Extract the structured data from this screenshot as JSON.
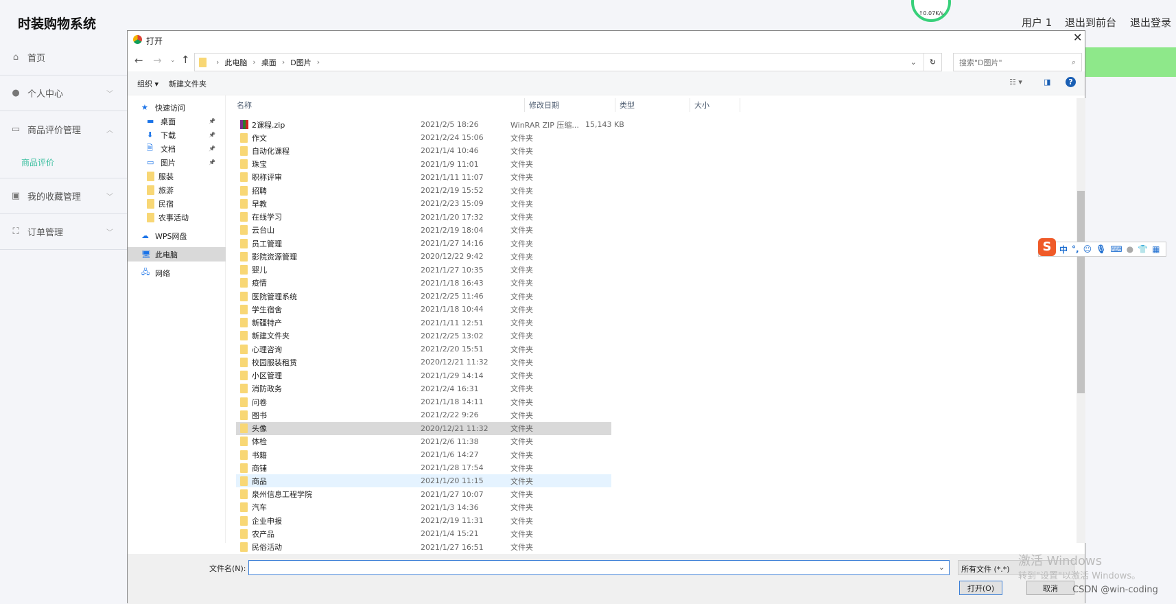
{
  "app": {
    "title": "时装购物系统",
    "user": "用户 1",
    "to_front": "退出到前台",
    "logout": "退出登录",
    "net_speed": "↑0.07K/s"
  },
  "sidebar": {
    "items": [
      {
        "label": "首页",
        "icon": "home-icon"
      },
      {
        "label": "个人中心",
        "icon": "user-icon"
      },
      {
        "label": "商品评价管理",
        "icon": "comment-icon"
      },
      {
        "label": "我的收藏管理",
        "icon": "clipboard-icon"
      },
      {
        "label": "订单管理",
        "icon": "order-icon"
      }
    ],
    "sub_item": "商品评价"
  },
  "dialog": {
    "title": "打开",
    "breadcrumb": [
      "此电脑",
      "桌面",
      "D图片"
    ],
    "search_placeholder": "搜索\"D图片\"",
    "organize": "组织 ▾",
    "new_folder": "新建文件夹",
    "nav": [
      {
        "label": "快速访问"
      },
      {
        "label": "桌面"
      },
      {
        "label": "下载"
      },
      {
        "label": "文档"
      },
      {
        "label": "图片"
      },
      {
        "label": "服装"
      },
      {
        "label": "旅游"
      },
      {
        "label": "民宿"
      },
      {
        "label": "农事活动"
      },
      {
        "label": "WPS网盘"
      },
      {
        "label": "此电脑"
      },
      {
        "label": "网络"
      }
    ],
    "columns": [
      "名称",
      "修改日期",
      "类型",
      "大小"
    ],
    "files": [
      {
        "name": "2课程.zip",
        "date": "2021/2/5 18:26",
        "type": "WinRAR ZIP 压缩...",
        "size": "15,143 KB",
        "zip": true
      },
      {
        "name": "作文",
        "date": "2021/2/24 15:06",
        "type": "文件夹"
      },
      {
        "name": "自动化课程",
        "date": "2021/1/4 10:46",
        "type": "文件夹"
      },
      {
        "name": "珠宝",
        "date": "2021/1/9 11:01",
        "type": "文件夹"
      },
      {
        "name": "职称评审",
        "date": "2021/1/11 11:07",
        "type": "文件夹"
      },
      {
        "name": "招聘",
        "date": "2021/2/19 15:52",
        "type": "文件夹"
      },
      {
        "name": "早教",
        "date": "2021/2/23 15:09",
        "type": "文件夹"
      },
      {
        "name": "在线学习",
        "date": "2021/1/20 17:32",
        "type": "文件夹"
      },
      {
        "name": "云台山",
        "date": "2021/2/19 18:04",
        "type": "文件夹"
      },
      {
        "name": "员工管理",
        "date": "2021/1/27 14:16",
        "type": "文件夹"
      },
      {
        "name": "影院资源管理",
        "date": "2020/12/22 9:42",
        "type": "文件夹"
      },
      {
        "name": "婴儿",
        "date": "2021/1/27 10:35",
        "type": "文件夹"
      },
      {
        "name": "疫情",
        "date": "2021/1/18 16:43",
        "type": "文件夹"
      },
      {
        "name": "医院管理系统",
        "date": "2021/2/25 11:46",
        "type": "文件夹"
      },
      {
        "name": "学生宿舍",
        "date": "2021/1/18 10:44",
        "type": "文件夹"
      },
      {
        "name": "新疆特产",
        "date": "2021/1/11 12:51",
        "type": "文件夹"
      },
      {
        "name": "新建文件夹",
        "date": "2021/2/25 13:02",
        "type": "文件夹"
      },
      {
        "name": "心理咨询",
        "date": "2021/2/20 15:51",
        "type": "文件夹"
      },
      {
        "name": "校园服装租赁",
        "date": "2020/12/21 11:32",
        "type": "文件夹"
      },
      {
        "name": "小区管理",
        "date": "2021/1/29 14:14",
        "type": "文件夹"
      },
      {
        "name": "消防政务",
        "date": "2021/2/4 16:31",
        "type": "文件夹"
      },
      {
        "name": "问卷",
        "date": "2021/1/18 14:11",
        "type": "文件夹"
      },
      {
        "name": "图书",
        "date": "2021/2/22 9:26",
        "type": "文件夹"
      },
      {
        "name": "头像",
        "date": "2020/12/21 11:32",
        "type": "文件夹",
        "selected": true
      },
      {
        "name": "体检",
        "date": "2021/2/6 11:38",
        "type": "文件夹"
      },
      {
        "name": "书籍",
        "date": "2021/1/6 14:27",
        "type": "文件夹"
      },
      {
        "name": "商铺",
        "date": "2021/1/28 17:54",
        "type": "文件夹"
      },
      {
        "name": "商品",
        "date": "2021/1/20 11:15",
        "type": "文件夹",
        "hover": true
      },
      {
        "name": "泉州信息工程学院",
        "date": "2021/1/27 10:07",
        "type": "文件夹"
      },
      {
        "name": "汽车",
        "date": "2021/1/3 14:36",
        "type": "文件夹"
      },
      {
        "name": "企业申报",
        "date": "2021/2/19 11:31",
        "type": "文件夹"
      },
      {
        "name": "农产品",
        "date": "2021/1/4 15:21",
        "type": "文件夹"
      },
      {
        "name": "民俗活动",
        "date": "2021/1/27 16:51",
        "type": "文件夹"
      }
    ],
    "filename_label": "文件名(N):",
    "filename_value": "",
    "filter": "所有文件 (*.*)",
    "open": "打开(O)",
    "cancel": "取消"
  },
  "ime": {
    "lang": "中",
    "punct": "°,"
  },
  "watermark": {
    "line1": "激活 Windows",
    "line2": "转到\"设置\"以激活 Windows。",
    "credit": "CSDN @win-coding"
  },
  "colors": {
    "accent": "#3cbfa0",
    "green_bar": "#8ee88a",
    "selected_row": "#d9d9d9",
    "hover_row": "#e5f3ff"
  }
}
